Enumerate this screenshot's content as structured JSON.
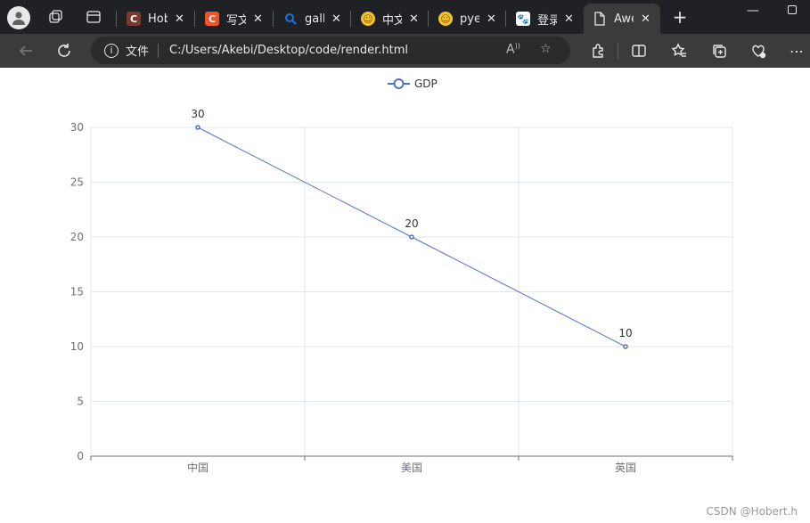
{
  "browser": {
    "tabs": [
      {
        "title": "Hob",
        "favicon": "C",
        "favicon_color": "#7a3a2a",
        "active": false
      },
      {
        "title": "写文",
        "favicon": "C",
        "favicon_color": "#f0522a",
        "active": false
      },
      {
        "title": "galle",
        "favicon": "search",
        "favicon_color": "#1a73e8",
        "active": false
      },
      {
        "title": "中文",
        "favicon": "face",
        "favicon_color": "#f2c230",
        "active": false
      },
      {
        "title": "pyec",
        "favicon": "face",
        "favicon_color": "#f2c230",
        "active": false
      },
      {
        "title": "登录",
        "favicon": "paw",
        "favicon_color": "#2a6fdb",
        "active": false
      },
      {
        "title": "Awe",
        "favicon": "page",
        "favicon_color": "#e8e8e8",
        "active": true
      }
    ],
    "new_tab_label": "+",
    "address": {
      "scheme_label": "文件",
      "url": "C:/Users/Akebi/Desktop/code/render.html"
    }
  },
  "chart_data": {
    "type": "line",
    "categories": [
      "中国",
      "美国",
      "英国"
    ],
    "series": [
      {
        "name": "GDP",
        "values": [
          30,
          20,
          10
        ],
        "color": "#5470c6"
      }
    ],
    "legend": {
      "position": "top-center",
      "label": "GDP"
    },
    "ylim": [
      0,
      30
    ],
    "yticks": [
      0,
      5,
      10,
      15,
      20,
      25,
      30
    ],
    "data_labels": [
      "30",
      "20",
      "10"
    ],
    "grid": true
  },
  "watermark": "CSDN @Hobert.h"
}
